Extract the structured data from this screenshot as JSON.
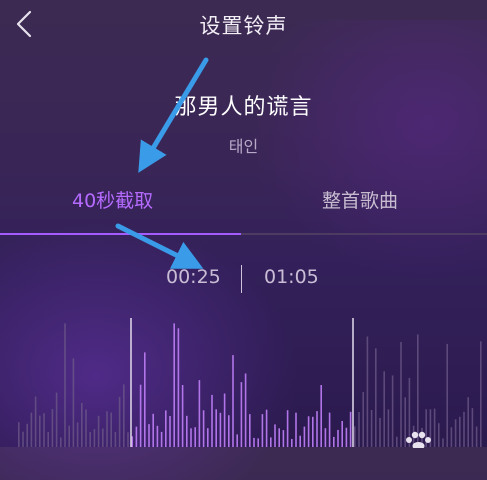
{
  "header": {
    "title": "设置铃声",
    "back_icon": "chevron-left-icon"
  },
  "song": {
    "title": "那男人的谎言",
    "artist": "태인"
  },
  "tabs": [
    {
      "label": "40秒截取",
      "active": true
    },
    {
      "label": "整首歌曲",
      "active": false
    }
  ],
  "selection": {
    "start_time": "00:25",
    "end_time": "01:05"
  },
  "colors": {
    "accent": "#a45cff",
    "bar_active": "#b87af0",
    "bar_inactive": "#6e5a88",
    "annotation_arrow": "#3a9be8"
  }
}
